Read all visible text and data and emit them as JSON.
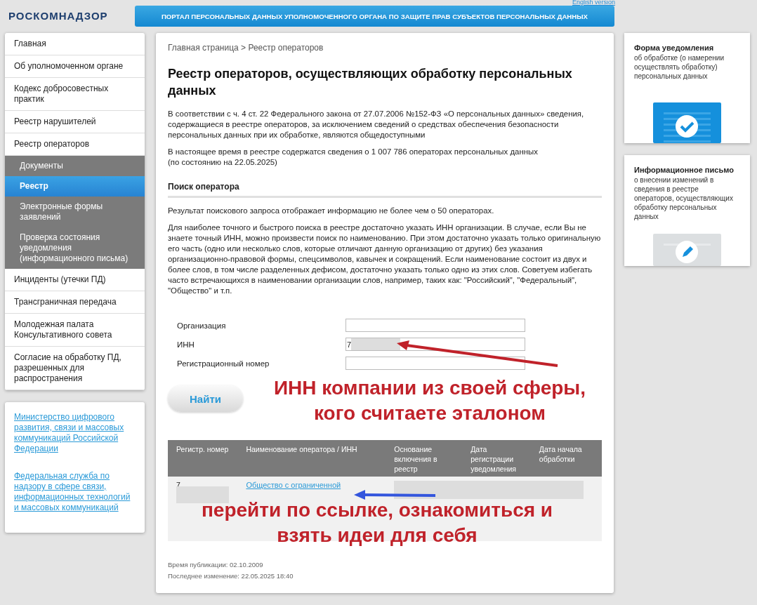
{
  "header": {
    "logo": "РОСКОМНАДЗОР",
    "english_link": "English version",
    "banner": "ПОРТАЛ ПЕРСОНАЛЬНЫХ ДАННЫХ УПОЛНОМОЧЕННОГО ОРГАНА ПО ЗАЩИТЕ ПРАВ СУБЪЕКТОВ ПЕРСОНАЛЬНЫХ ДАННЫХ"
  },
  "sidebar": {
    "items": [
      {
        "label": "Главная",
        "selected": false
      },
      {
        "label": "Об уполномоченном органе",
        "selected": false
      },
      {
        "label": "Кодекс добросовестных практик",
        "selected": false
      },
      {
        "label": "Реестр нарушителей",
        "selected": false
      },
      {
        "label": "Реестр операторов",
        "selected": false,
        "expanded": true,
        "children": [
          {
            "label": "Документы",
            "selected": false
          },
          {
            "label": "Реестр",
            "selected": true
          },
          {
            "label": "Электронные формы заявлений",
            "selected": false
          },
          {
            "label": "Проверка состояния уведомления (информационного письма)",
            "selected": false
          }
        ]
      },
      {
        "label": "Инциденты (утечки ПД)",
        "selected": false
      },
      {
        "label": "Трансграничная передача",
        "selected": false
      },
      {
        "label": "Молодежная палата Консультативного совета",
        "selected": false
      },
      {
        "label": "Согласие на обработку ПД, разрешенных для распространения",
        "selected": false
      }
    ],
    "links": [
      "Министерство цифрового развития, связи и массовых коммуникаций Российской Федерации",
      "Федеральная служба по надзору в сфере связи, информационных технологий и массовых коммуникаций"
    ]
  },
  "main": {
    "breadcrumb": "Главная страница > Реестр операторов",
    "title": "Реестр операторов, осуществляющих обработку персональных данных",
    "intro": [
      "В соответствии с ч. 4 ст. 22 Федерального закона от 27.07.2006 №152-ФЗ «О персональных данных» сведения, содержащиеся в реестре операторов, за исключением сведений о средствах обеспечения безопасности персональных данных при их обработке, являются общедоступными",
      "В настоящее время в реестре содержатся сведения о 1 007 786 операторах персональных данных\n(по состоянию на 22.05.2025)"
    ],
    "search_heading": "Поиск оператора",
    "search_notes": [
      "Результат поискового запроса отображает информацию не более чем о 50 операторах.",
      "Для наиболее точного и быстрого поиска в реестре достаточно указать ИНН организации. В случае, если Вы не знаете точный ИНН, можно произвести поиск по наименованию. При этом достаточно указать только оригинальную его часть (одно или несколько слов, которые отличают данную организацию от других) без указания организационно-правовой формы, спецсимволов, кавычек и сокращений. Если наименование состоит из двух и более слов, в том числе разделенных дефисом, достаточно указать только одно из этих слов. Советуем избегать часто встречающихся в наименовании организации слов, например, таких как: \"Российский\", \"Федеральный\", \"Общество\" и т.п."
    ],
    "form": {
      "fields": [
        {
          "label": "Организация"
        },
        {
          "label": "ИНН",
          "value": "7",
          "redacted": true
        },
        {
          "label": "Регистрационный номер"
        }
      ],
      "button": "Найти"
    },
    "table": {
      "columns": [
        "Регистр. номер",
        "Наименование оператора / ИНН",
        "Основание включения в реестр",
        "Дата регистрации уведомления",
        "Дата начала обработки"
      ],
      "rows": [
        {
          "reg_number": "7",
          "name": "Общество с ограниченной"
        }
      ]
    },
    "footer": [
      "Время публикации: 02.10.2009",
      "Последнее изменение: 22.05.2025 18:40"
    ]
  },
  "cards": [
    {
      "kind": "check",
      "title": "Форма уведомления",
      "text": "об обработке (о намерении осуществлять обработку) персональных данных"
    },
    {
      "kind": "edit",
      "title": "Информационное письмо",
      "text": "о внесении изменений в сведения в реестре операторов, осуществляющих обработку персональных данных"
    }
  ],
  "annotations": [
    {
      "kind": "inn",
      "text": "ИНН компании из своей сферы,\nкого считаете эталоном",
      "color": "#c0222a"
    },
    {
      "kind": "link",
      "text": "перейти по ссылке, ознакомиться и\nвзять идеи для себя",
      "color": "#c0222a"
    }
  ]
}
